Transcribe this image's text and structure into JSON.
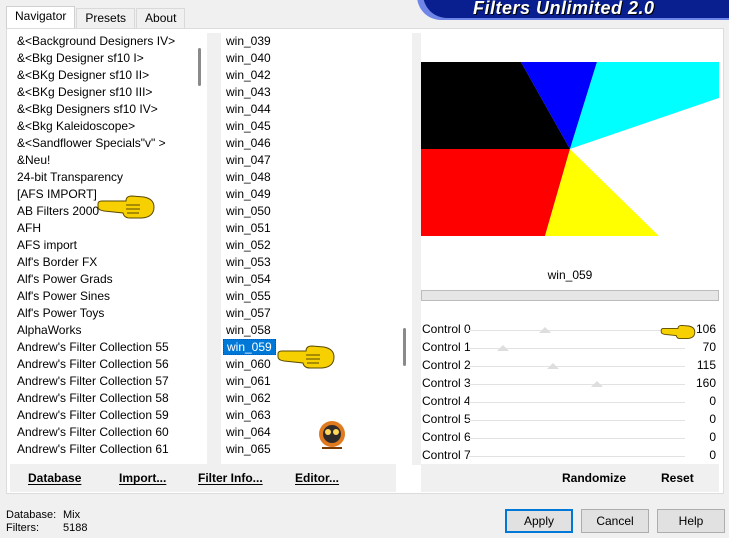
{
  "app": {
    "banner_title": "Filters Unlimited 2.0"
  },
  "tabs": [
    "Navigator",
    "Presets",
    "About"
  ],
  "categories": [
    "&<Background Designers IV>",
    "&<Bkg Designer sf10 I>",
    "&<BKg Designer sf10 II>",
    "&<BKg Designer sf10 III>",
    "&<Bkg Designers sf10 IV>",
    "&<Bkg Kaleidoscope>",
    "&<Sandflower Specials\"v\" >",
    "&Neu!",
    "24-bit Transparency",
    "[AFS IMPORT]",
    "AB Filters 2000",
    "AFH",
    "AFS import",
    "Alf's Border FX",
    "Alf's Power Grads",
    "Alf's Power Sines",
    "Alf's Power Toys",
    "AlphaWorks",
    "Andrew's Filter Collection 55",
    "Andrew's Filter Collection 56",
    "Andrew's Filter Collection 57",
    "Andrew's Filter Collection 58",
    "Andrew's Filter Collection 59",
    "Andrew's Filter Collection 60",
    "Andrew's Filter Collection 61"
  ],
  "filters": [
    "win_039",
    "win_040",
    "win_042",
    "win_043",
    "win_044",
    "win_045",
    "win_046",
    "win_047",
    "win_048",
    "win_049",
    "win_050",
    "win_051",
    "win_052",
    "win_053",
    "win_054",
    "win_055",
    "win_057",
    "win_058",
    "win_059",
    "win_060",
    "win_061",
    "win_062",
    "win_063",
    "win_064",
    "win_065"
  ],
  "selected_filter_index": 18,
  "preview": {
    "label": "win_059"
  },
  "controls": [
    {
      "label": "Control 0",
      "value": "106"
    },
    {
      "label": "Control 1",
      "value": "70"
    },
    {
      "label": "Control 2",
      "value": "115"
    },
    {
      "label": "Control 3",
      "value": "160"
    },
    {
      "label": "Control 4",
      "value": "0"
    },
    {
      "label": "Control 5",
      "value": "0"
    },
    {
      "label": "Control 6",
      "value": "0"
    },
    {
      "label": "Control 7",
      "value": "0"
    }
  ],
  "toolbar": {
    "database": "Database",
    "import": "Import...",
    "filter_info": "Filter Info...",
    "editor": "Editor...",
    "randomize": "Randomize",
    "reset": "Reset"
  },
  "footer": {
    "database_label": "Database:",
    "database_value": "Mix",
    "filters_label": "Filters:",
    "filters_value": "5188",
    "apply": "Apply",
    "cancel": "Cancel",
    "help": "Help"
  },
  "colors": {
    "selection": "#0078d7",
    "banner": "#0a1f8f",
    "preview_black": "#000000",
    "preview_blue": "#0000ff",
    "preview_cyan": "#00ffff",
    "preview_red": "#ff0000",
    "preview_yellow": "#ffff00",
    "pointer_hand": "#f6d000"
  },
  "icons": [
    "hand-pointer-icon",
    "watermark-logo"
  ]
}
